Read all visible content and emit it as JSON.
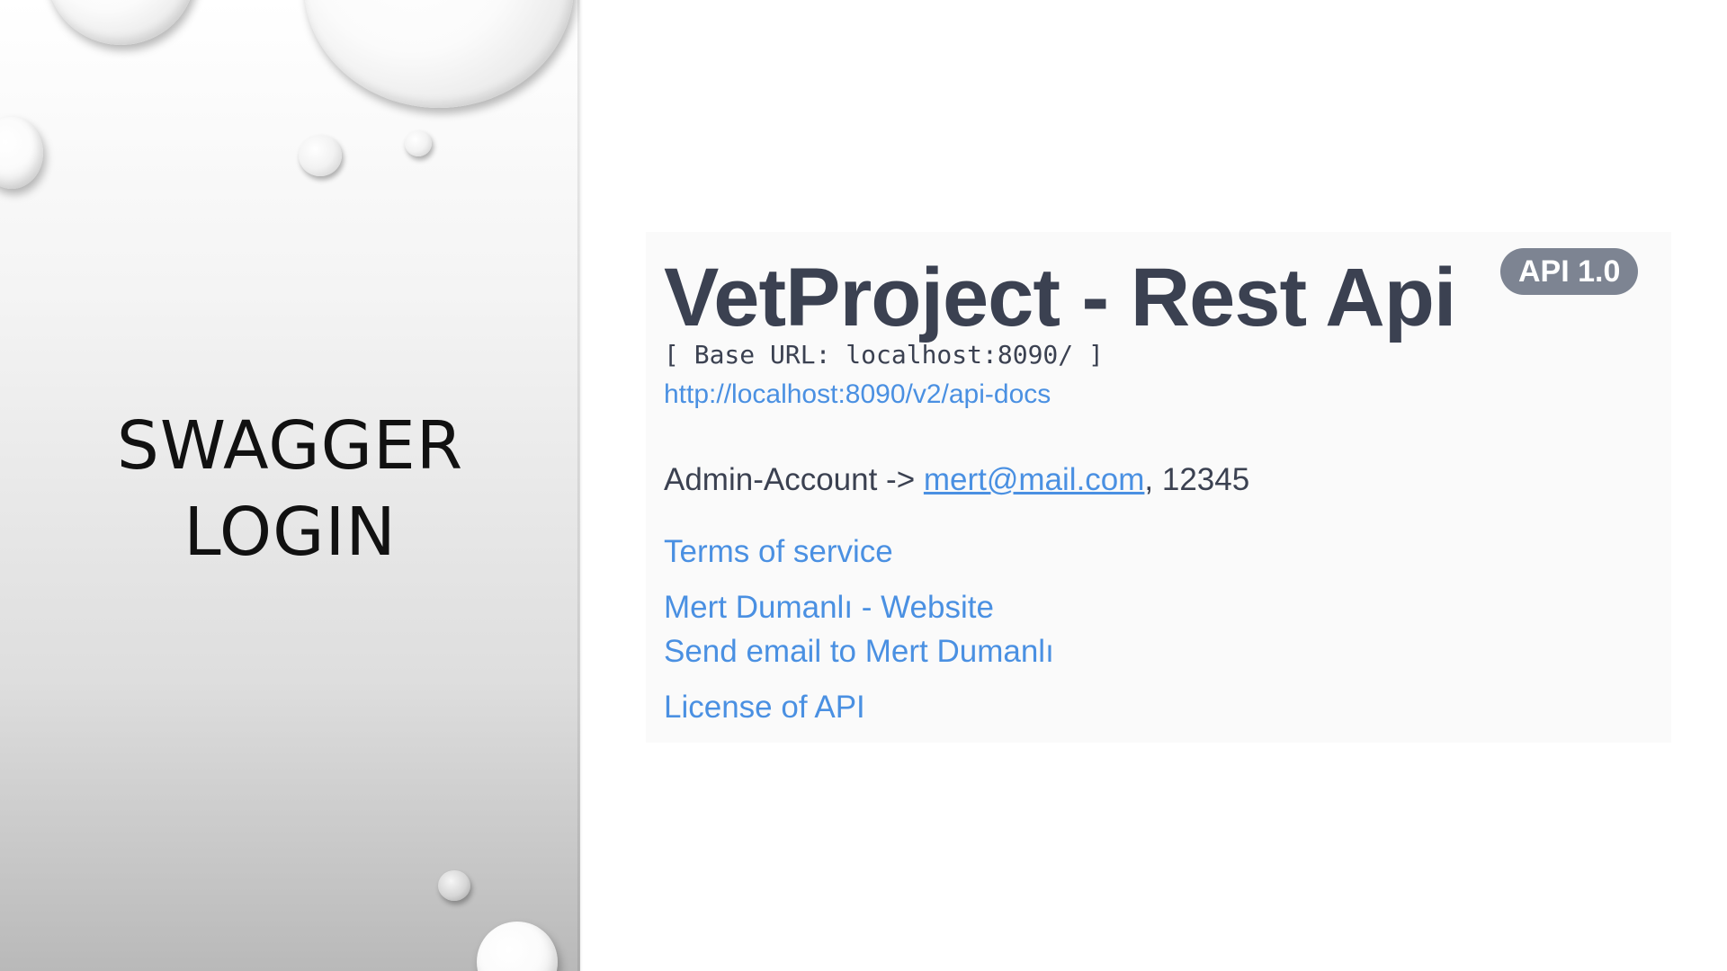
{
  "slide": {
    "title_line1": "SWAGGER",
    "title_line2": "LOGIN"
  },
  "swagger_info": {
    "title": "VetProject - Rest Api",
    "version_badge": "API 1.0",
    "base_url": "[ Base URL: localhost:8090/ ]",
    "docs_link": "http://localhost:8090/v2/api-docs",
    "admin_prefix": "Admin-Account -> ",
    "admin_email": "mert@mail.com",
    "admin_suffix": ", 12345",
    "links": {
      "terms": "Terms of service",
      "website": "Mert Dumanlı - Website",
      "email": "Send email to Mert Dumanlı",
      "license": "License of API"
    }
  },
  "colors": {
    "title": "#3b4151",
    "link": "#4a90e2",
    "badge": "#7d8492",
    "box_background": "#fafafa"
  }
}
